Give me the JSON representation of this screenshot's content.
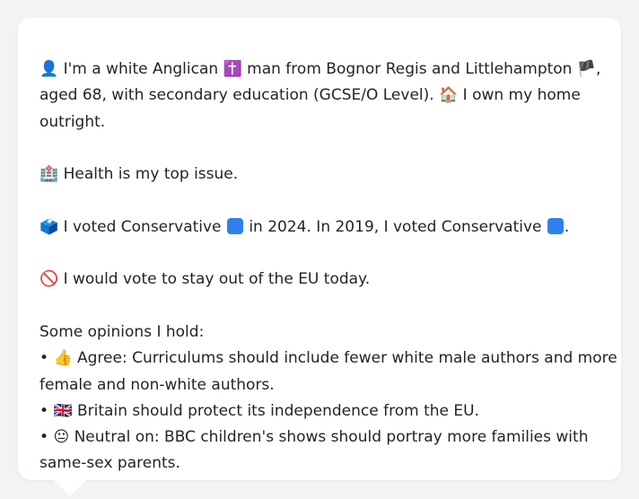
{
  "intro": {
    "line1_before_cross": "I'm a white Anglican",
    "line1_after_cross": "man from Bognor Regis and Littlehampton",
    "line2_text": "aged 68, with secondary education (GCSE/O Level).",
    "line2_home": "I own my home",
    "line3_text": "outright."
  },
  "health": "Health is my top issue.",
  "votes": {
    "part1": "I voted Conservative",
    "part2": "in 2024. In 2019, I voted Conservative",
    "part3": "."
  },
  "eu": "I would vote to stay out of the EU today.",
  "opinions_heading": "Some opinions I hold:",
  "opinions": [
    {
      "bullet": "•",
      "text_line1": "Agree: Curriculums should include fewer white male authors and more",
      "text_line2": "female and non-white authors."
    },
    {
      "bullet": "•",
      "text_line1": "Britain should protect its independence from the EU."
    },
    {
      "bullet": "•",
      "text_line1": "Neutral on: BBC children's shows should portray more families with",
      "text_line2": "same-sex parents."
    }
  ],
  "icons": {
    "person": "👤",
    "cross": "✝️",
    "england_flag": "🏴",
    "house": "🏠",
    "hospital": "🏥",
    "ballot": "🗳️",
    "no_entry": "🚫",
    "thumbs_up": "👍",
    "uk_flag": "🇬🇧",
    "neutral_face": "😐"
  }
}
